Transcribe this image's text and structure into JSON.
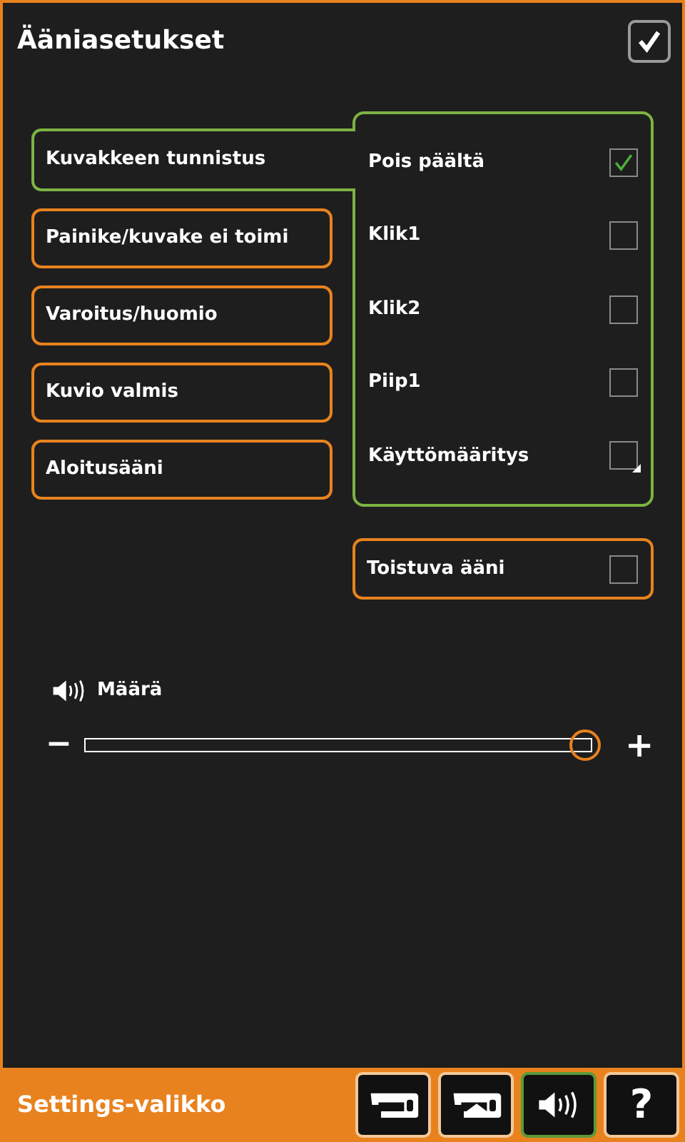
{
  "window": {
    "title": "Ääniasetukset",
    "confirm_checked": true
  },
  "events": [
    {
      "label": "Kuvakkeen tunnistus",
      "selected": true
    },
    {
      "label": "Painike/kuvake ei toimi",
      "selected": false
    },
    {
      "label": "Varoitus/huomio",
      "selected": false
    },
    {
      "label": "Kuvio valmis",
      "selected": false
    },
    {
      "label": "Aloitusääni",
      "selected": false
    }
  ],
  "sounds": [
    {
      "label": "Pois päältä",
      "checked": true,
      "has_submenu": false
    },
    {
      "label": "Klik1",
      "checked": false,
      "has_submenu": false
    },
    {
      "label": "Klik2",
      "checked": false,
      "has_submenu": false
    },
    {
      "label": "Piip1",
      "checked": false,
      "has_submenu": false
    },
    {
      "label": "Käyttömääritys",
      "checked": false,
      "has_submenu": true
    }
  ],
  "repeat": {
    "label": "Toistuva ääni",
    "checked": false
  },
  "volume": {
    "label": "Määrä",
    "minus": "−",
    "plus": "+",
    "level": 0.99
  },
  "bottom_bar": {
    "title": "Settings-valikko",
    "buttons": [
      {
        "kind": "sewing",
        "selected": false
      },
      {
        "kind": "embroidery",
        "selected": false
      },
      {
        "kind": "sound",
        "selected": true
      },
      {
        "kind": "help",
        "text": "?",
        "selected": false
      }
    ]
  }
}
